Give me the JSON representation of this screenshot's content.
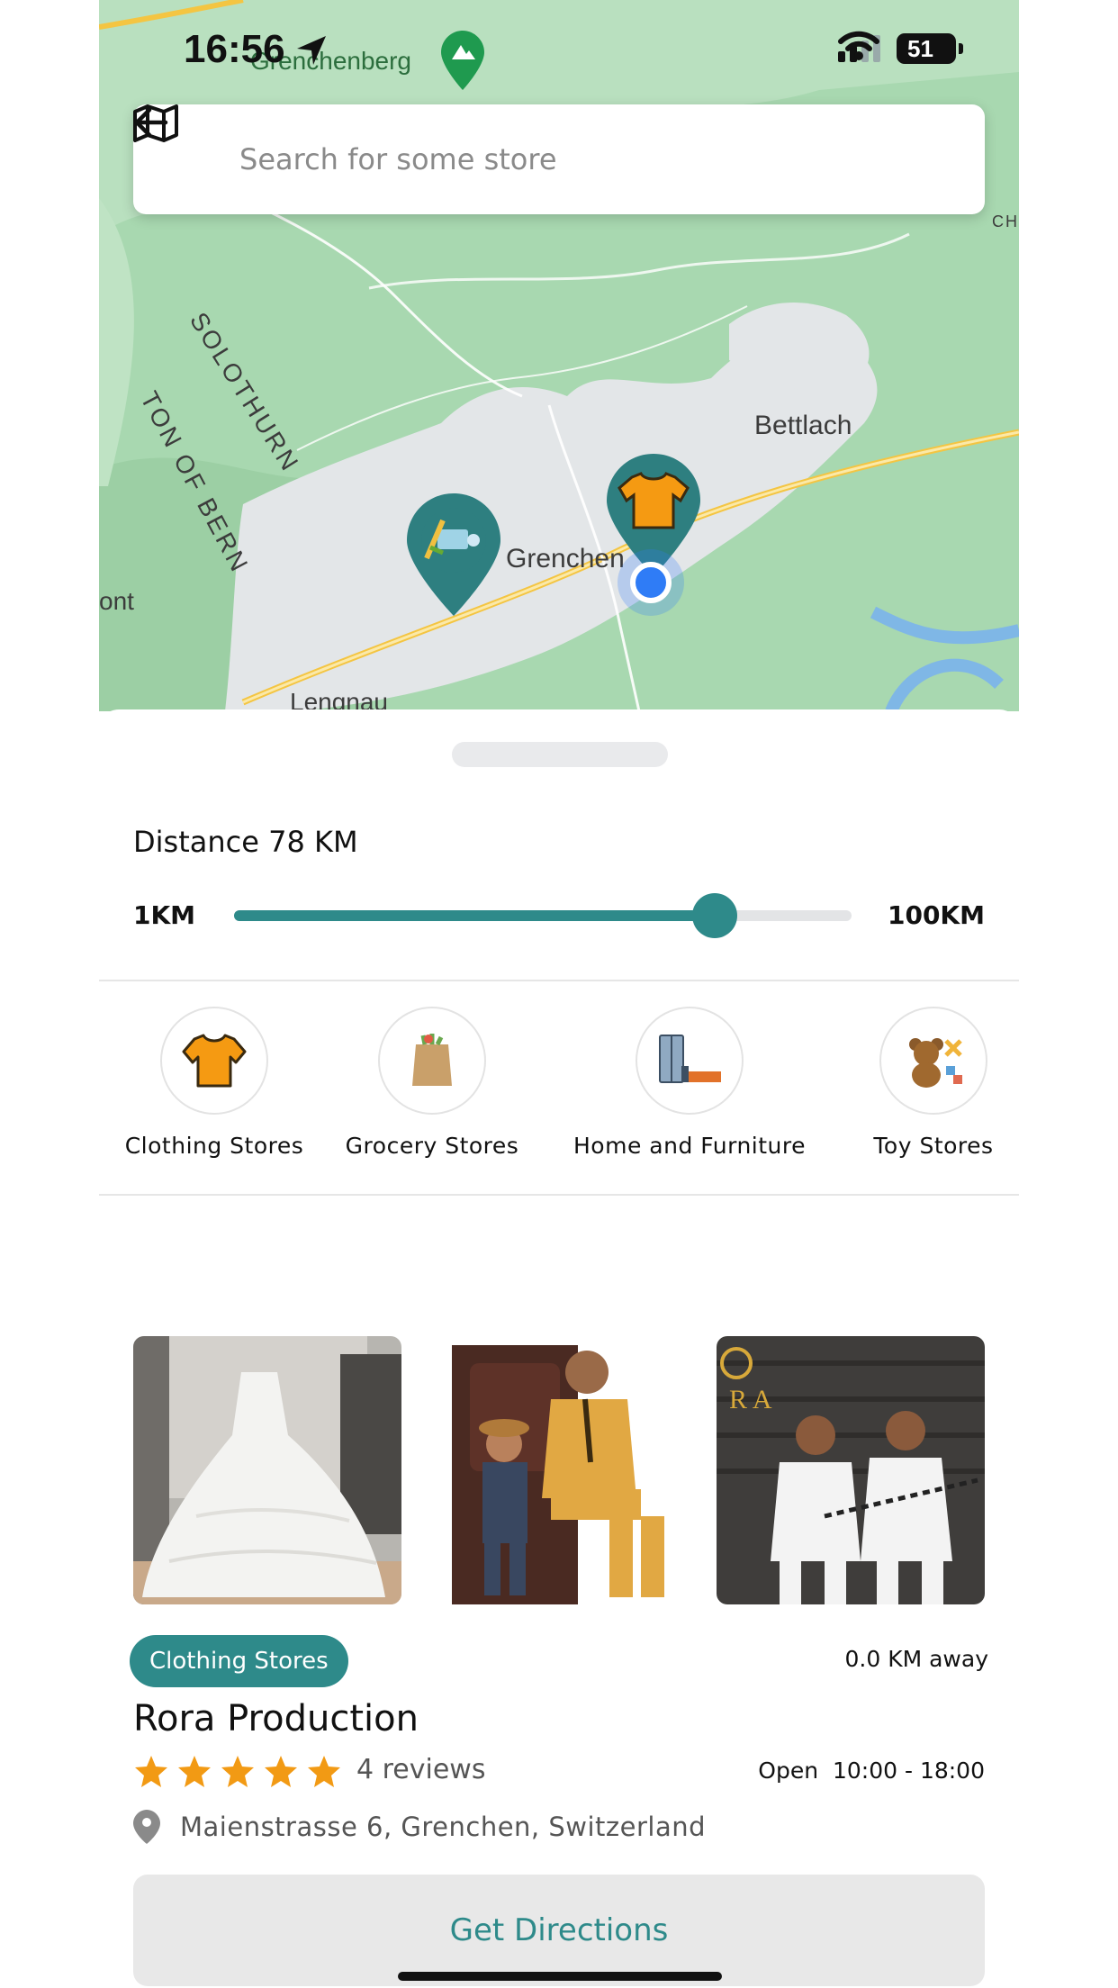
{
  "status": {
    "time": "16:56",
    "battery": "51"
  },
  "search": {
    "placeholder": "Search for some store"
  },
  "map": {
    "labels": [
      "Grenchenberg",
      "Bettlach",
      "Grenchen",
      "SOLOTHURN",
      "TON OF BERN",
      "ont",
      "Lengnau",
      "CH"
    ],
    "pins": [
      {
        "category": "Toy Stores",
        "icon": "toy-icon"
      },
      {
        "category": "Clothing Stores",
        "icon": "tshirt-icon"
      }
    ]
  },
  "filter": {
    "distance_label": "Distance 78 KM",
    "min_label": "1KM",
    "max_label": "100KM",
    "min": 1,
    "max": 100,
    "value": 78
  },
  "categories": [
    {
      "label": "Clothing Stores",
      "icon": "tshirt-icon"
    },
    {
      "label": "Grocery Stores",
      "icon": "grocery-bag-icon"
    },
    {
      "label": "Home and Furniture",
      "icon": "furniture-icon"
    },
    {
      "label": "Toy Stores",
      "icon": "teddy-bear-icon"
    }
  ],
  "store": {
    "category": "Clothing Stores",
    "distance": "0.0 KM away",
    "name": "Rora Production",
    "rating": 5,
    "reviews": "4 reviews",
    "open_label": "Open",
    "hours": "10:00 - 18:00",
    "address": "Maienstrasse 6, Grenchen, Switzerland",
    "photo_text": "R A",
    "cta": "Get Directions"
  },
  "colors": {
    "accent": "#2e8a8a",
    "star": "#f29a14",
    "map_green": "#a8d8b0"
  }
}
